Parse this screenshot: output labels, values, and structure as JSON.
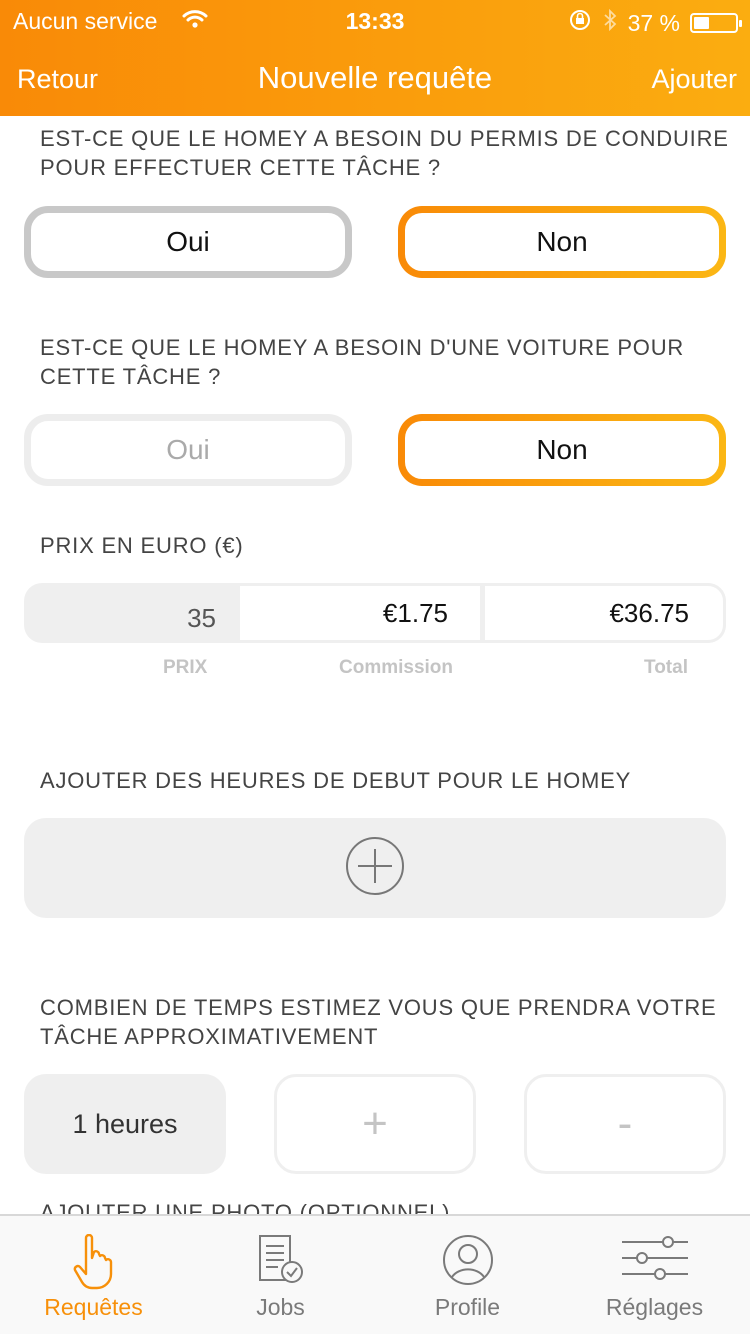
{
  "status_bar": {
    "carrier": "Aucun service",
    "time": "13:33",
    "battery": "37 %",
    "battery_level": 0.37
  },
  "nav": {
    "back_label": "Retour",
    "title": "Nouvelle requête",
    "add_label": "Ajouter"
  },
  "questions": {
    "permis": {
      "label": "EST-CE QUE LE HOMEY A BESOIN DU PERMIS DE CONDUIRE POUR EFFECTUER CETTE TÂCHE ?",
      "oui": "Oui",
      "non": "Non",
      "selected": "Non"
    },
    "voiture": {
      "label": "EST-CE QUE LE HOMEY A BESOIN D'UNE VOITURE POUR CETTE TÂCHE ?",
      "oui": "Oui",
      "non": "Non",
      "selected": "Non"
    }
  },
  "price": {
    "label": "PRIX EN EURO (€)",
    "prix_value": "35",
    "commission_value": "€1.75",
    "total_value": "€36.75",
    "prix_caption": "PRIX",
    "commission_caption": "Commission",
    "total_caption": "Total"
  },
  "start_hours": {
    "label": "AJOUTER DES HEURES DE DEBUT POUR LE HOMEY"
  },
  "duration": {
    "label": "COMBIEN DE TEMPS ESTIMEZ VOUS QUE PRENDRA VOTRE TÂCHE APPROXIMATIVEMENT",
    "value": "1 heures",
    "plus": "+",
    "minus": "-"
  },
  "photo": {
    "label": "AJOUTER UNE PHOTO (OPTIONNEL)"
  },
  "tabs": [
    {
      "label": "Requêtes",
      "icon": "hand-pointer-icon",
      "active": true
    },
    {
      "label": "Jobs",
      "icon": "document-check-icon",
      "active": false
    },
    {
      "label": "Profile",
      "icon": "user-circle-icon",
      "active": false
    },
    {
      "label": "Réglages",
      "icon": "sliders-icon",
      "active": false
    }
  ],
  "colors": {
    "accent_start": "#f98a07",
    "accent_end": "#fbad10",
    "active_tab": "#f7900a"
  }
}
